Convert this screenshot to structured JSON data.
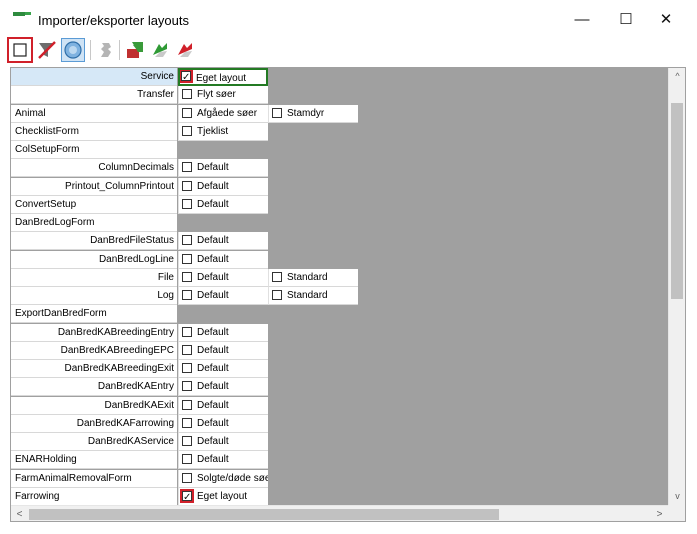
{
  "window": {
    "title": "Importer/eksporter layouts",
    "controls": {
      "minimize": "—",
      "maximize": "☐",
      "close": "✕"
    },
    "accent": "#2e8b3e"
  },
  "toolbar": {
    "buttons": [
      {
        "icon": "checkbox-select-all-icon",
        "highlighted": true
      },
      {
        "icon": "filter-clear-icon"
      },
      {
        "icon": "globe-icon",
        "pressed": true
      },
      {
        "icon": "print-disabled-icon"
      },
      {
        "icon": "import-icon"
      },
      {
        "icon": "export-green-icon"
      },
      {
        "icon": "export-red-icon"
      }
    ],
    "highlight_color": "#d0202a"
  },
  "grid": {
    "rows": [
      {
        "name": "Service",
        "indent": true,
        "selected": true,
        "c1": {
          "checked": true,
          "label": "Eget layout",
          "highlight": true,
          "active": true
        },
        "c2": null
      },
      {
        "name": "Transfer",
        "indent": true,
        "c1": {
          "checked": false,
          "label": "Flyt søer"
        },
        "c2": null
      },
      {
        "name": "Animal",
        "indent": false,
        "c1": {
          "checked": false,
          "label": "Afgåede søer"
        },
        "c2": {
          "checked": false,
          "label": "Stamdyr"
        }
      },
      {
        "name": "ChecklistForm",
        "indent": false,
        "c1": {
          "checked": false,
          "label": "Tjeklist"
        },
        "c2": null
      },
      {
        "name": "ColSetupForm",
        "indent": false,
        "c1": null,
        "c2": null
      },
      {
        "name": "ColumnDecimals",
        "indent": true,
        "c1": {
          "checked": false,
          "label": "Default"
        },
        "c2": null
      },
      {
        "name": "Printout_ColumnPrintout",
        "indent": true,
        "c1": {
          "checked": false,
          "label": "Default"
        },
        "c2": null
      },
      {
        "name": "ConvertSetup",
        "indent": false,
        "c1": {
          "checked": false,
          "label": "Default"
        },
        "c2": null
      },
      {
        "name": "DanBredLogForm",
        "indent": false,
        "c1": null,
        "c2": null
      },
      {
        "name": "DanBredFileStatus",
        "indent": true,
        "c1": {
          "checked": false,
          "label": "Default"
        },
        "c2": null
      },
      {
        "name": "DanBredLogLine",
        "indent": true,
        "c1": {
          "checked": false,
          "label": "Default"
        },
        "c2": null
      },
      {
        "name": "File",
        "indent": true,
        "c1": {
          "checked": false,
          "label": "Default"
        },
        "c2": {
          "checked": false,
          "label": "Standard"
        }
      },
      {
        "name": "Log",
        "indent": true,
        "c1": {
          "checked": false,
          "label": "Default"
        },
        "c2": {
          "checked": false,
          "label": "Standard"
        }
      },
      {
        "name": "ExportDanBredForm",
        "indent": false,
        "c1": null,
        "c2": null
      },
      {
        "name": "DanBredKABreedingEntry",
        "indent": true,
        "c1": {
          "checked": false,
          "label": "Default"
        },
        "c2": null
      },
      {
        "name": "DanBredKABreedingEPC",
        "indent": true,
        "c1": {
          "checked": false,
          "label": "Default"
        },
        "c2": null
      },
      {
        "name": "DanBredKABreedingExit",
        "indent": true,
        "c1": {
          "checked": false,
          "label": "Default"
        },
        "c2": null
      },
      {
        "name": "DanBredKAEntry",
        "indent": true,
        "c1": {
          "checked": false,
          "label": "Default"
        },
        "c2": null
      },
      {
        "name": "DanBredKAExit",
        "indent": true,
        "c1": {
          "checked": false,
          "label": "Default"
        },
        "c2": null
      },
      {
        "name": "DanBredKAFarrowing",
        "indent": true,
        "c1": {
          "checked": false,
          "label": "Default"
        },
        "c2": null
      },
      {
        "name": "DanBredKAService",
        "indent": true,
        "c1": {
          "checked": false,
          "label": "Default"
        },
        "c2": null
      },
      {
        "name": "ENARHolding",
        "indent": false,
        "c1": {
          "checked": false,
          "label": "Default"
        },
        "c2": null
      },
      {
        "name": "FarmAnimalRemovalForm",
        "indent": false,
        "c1": {
          "checked": false,
          "label": "Solgte/døde søer"
        },
        "c2": null
      },
      {
        "name": "Farrowing",
        "indent": false,
        "c1": {
          "checked": true,
          "label": "Eget layout",
          "highlight": true
        },
        "c2": null
      }
    ]
  },
  "scrollbars": {
    "up_arrow": "^",
    "down_arrow": "v",
    "left_arrow": "<",
    "right_arrow": ">"
  }
}
